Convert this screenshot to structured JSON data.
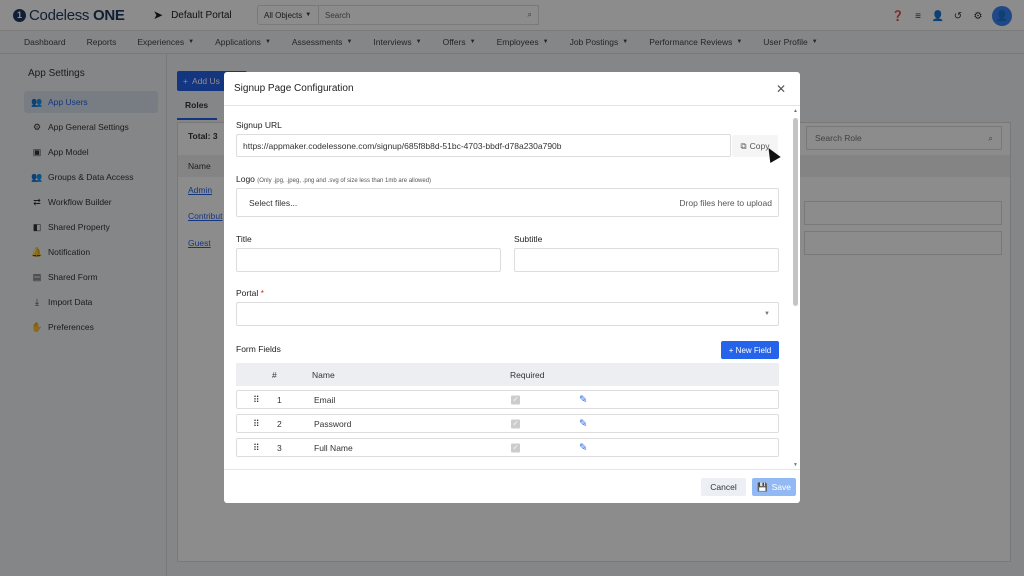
{
  "app": {
    "logo_mark": "1",
    "logo_name": "Codeless",
    "logo_suffix": "ONE",
    "portal_name": "Default Portal"
  },
  "topbar": {
    "scope": "All Objects",
    "search_placeholder": "Search"
  },
  "nav": [
    "Dashboard",
    "Reports",
    "Experiences",
    "Applications",
    "Assessments",
    "Interviews",
    "Offers",
    "Employees",
    "Job Postings",
    "Performance Reviews",
    "User Profile"
  ],
  "nav_dropdown": [
    false,
    false,
    true,
    true,
    true,
    true,
    true,
    true,
    true,
    true,
    true
  ],
  "sidebar": {
    "title": "App Settings",
    "items": [
      {
        "label": "App Users",
        "icon": "users-icon",
        "active": true
      },
      {
        "label": "App General Settings",
        "icon": "gear-icon"
      },
      {
        "label": "App Model",
        "icon": "cube-icon"
      },
      {
        "label": "Groups & Data Access",
        "icon": "groups-icon"
      },
      {
        "label": "Workflow Builder",
        "icon": "workflow-icon"
      },
      {
        "label": "Shared Property",
        "icon": "shared-property-icon"
      },
      {
        "label": "Notification",
        "icon": "bell-icon"
      },
      {
        "label": "Shared Form",
        "icon": "form-icon"
      },
      {
        "label": "Import Data",
        "icon": "import-icon"
      },
      {
        "label": "Preferences",
        "icon": "preferences-icon"
      }
    ]
  },
  "main": {
    "add_label": "Add Us",
    "tab": "Roles",
    "total": "Total: 3",
    "col_name": "Name",
    "roles": [
      "Admin",
      "Contribut",
      "Guest"
    ],
    "search_role_placeholder": "Search Role"
  },
  "modal": {
    "title": "Signup Page Configuration",
    "signup_url_label": "Signup URL",
    "signup_url": "https://appmaker.codelessone.com/signup/685f8b8d-51bc-4703-bbdf-d78a230a790b",
    "copy_label": "Copy",
    "logo_label": "Logo",
    "logo_hint": "(Only .jpg, .jpeg, .png and .svg of size less than 1mb are allowed)",
    "select_files": "Select files...",
    "drop_hint": "Drop files here to upload",
    "title_label": "Title",
    "subtitle_label": "Subtitle",
    "portal_label": "Portal",
    "required_mark": "*",
    "form_fields_label": "Form Fields",
    "new_field_label": "+ New Field",
    "columns": {
      "num": "#",
      "name": "Name",
      "required": "Required"
    },
    "fields": [
      {
        "num": "1",
        "name": "Email"
      },
      {
        "num": "2",
        "name": "Password"
      },
      {
        "num": "3",
        "name": "Full Name"
      }
    ],
    "cancel_label": "Cancel",
    "save_label": "Save"
  },
  "colors": {
    "accent": "#2563eb",
    "save_disabled": "#93b9f5",
    "logo": "#1e3a5f"
  }
}
